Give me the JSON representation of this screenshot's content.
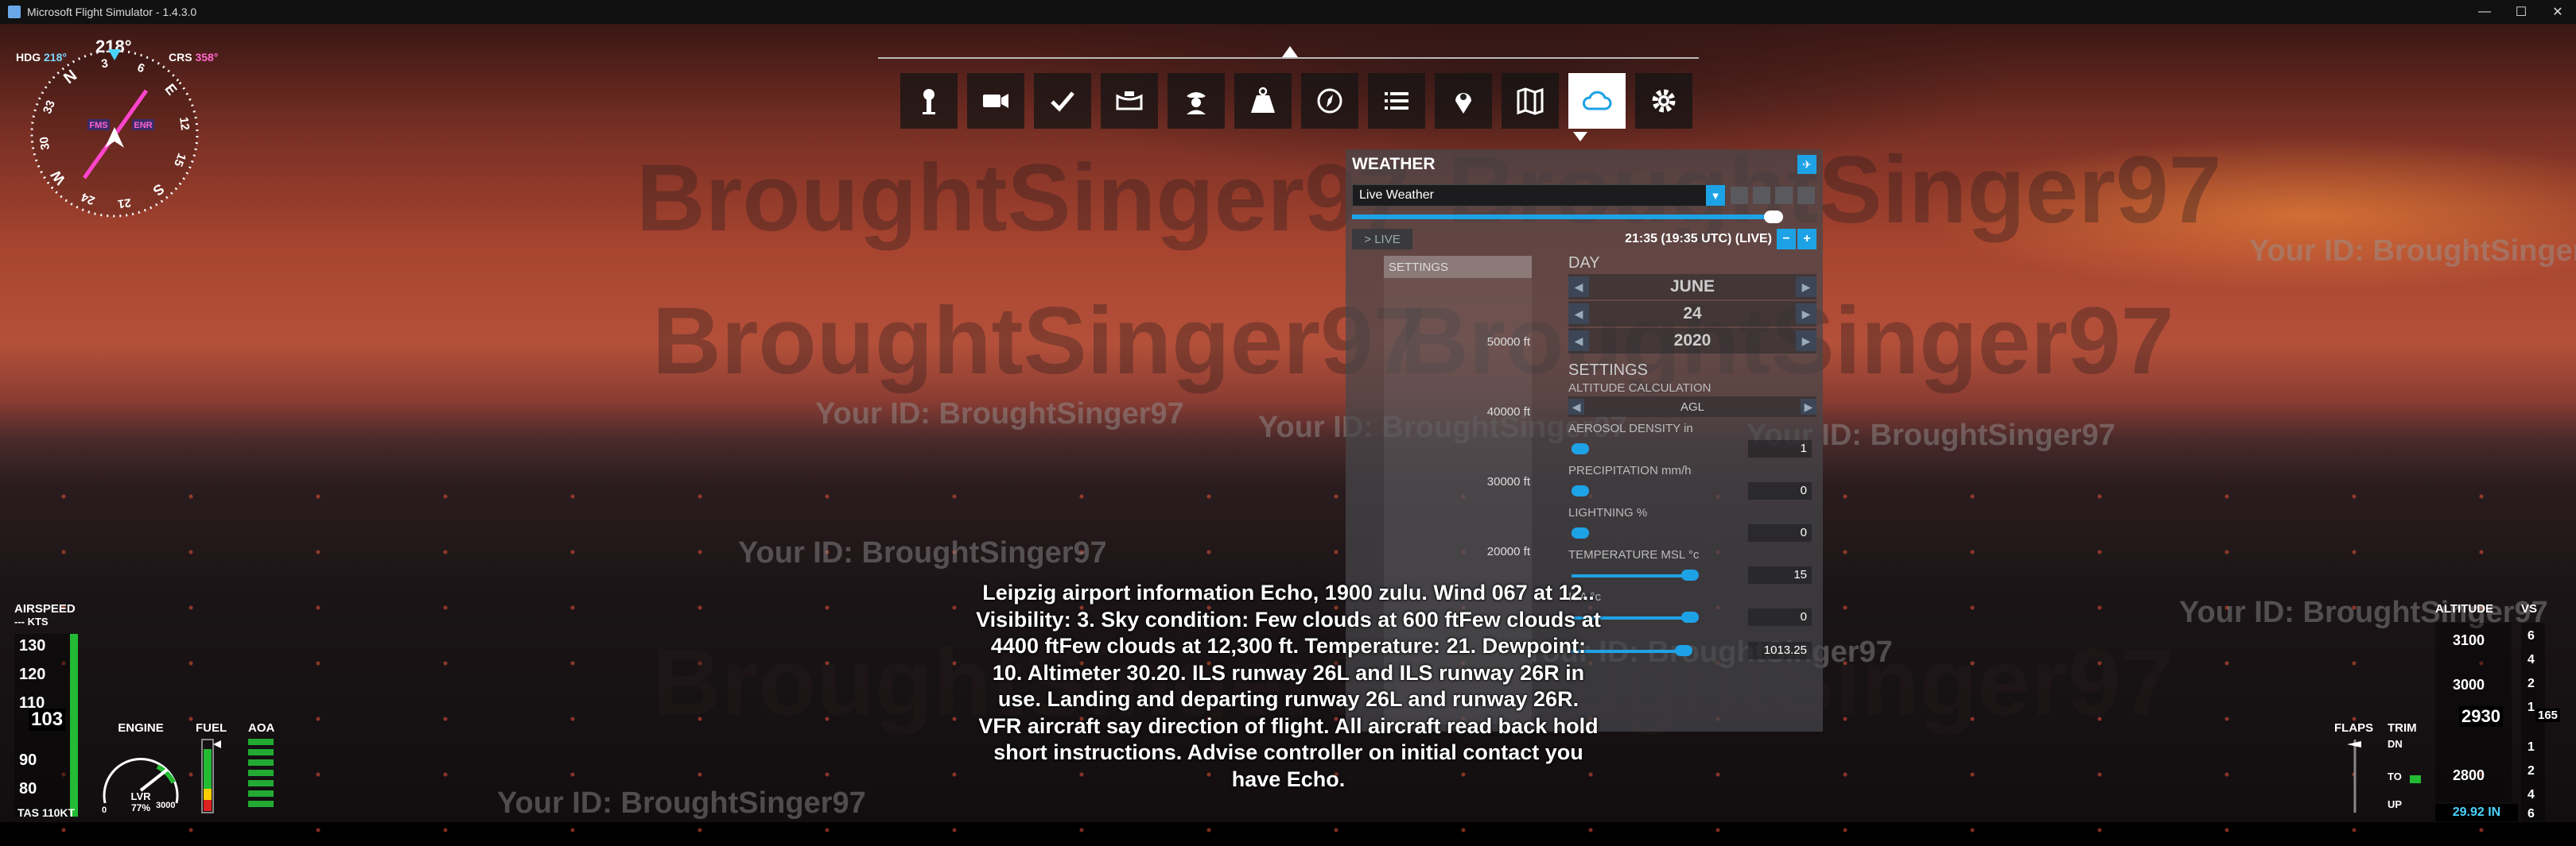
{
  "window": {
    "title": "Microsoft Flight Simulator - 1.4.3.0",
    "controls": [
      "—",
      "☐",
      "✕"
    ]
  },
  "watermark": {
    "text": "Your ID: BroughtSinger97",
    "big_text": "BroughtSinger97"
  },
  "toolbar": {
    "buttons": [
      {
        "icon": "atc-tower-icon"
      },
      {
        "icon": "camera-icon"
      },
      {
        "icon": "checklist-icon"
      },
      {
        "icon": "controls-icon"
      },
      {
        "icon": "copilot-icon"
      },
      {
        "icon": "weight-icon"
      },
      {
        "icon": "compass-icon"
      },
      {
        "icon": "list-icon"
      },
      {
        "icon": "map-pin-icon"
      },
      {
        "icon": "vfr-map-icon"
      },
      {
        "icon": "weather-cloud-icon",
        "active": true
      },
      {
        "icon": "settings-gear-icon"
      }
    ]
  },
  "weather_panel": {
    "title": "WEATHER",
    "preset": "Live Weather",
    "live_label": "LIVE",
    "time": "21:35 (19:35 UTC) (LIVE)",
    "settings_header": "SETTINGS",
    "altitudes": [
      "50000 ft",
      "40000 ft",
      "30000 ft",
      "20000 ft"
    ],
    "day_header": "DAY",
    "month": "JUNE",
    "day": "24",
    "year": "2020",
    "settings_title": "SETTINGS",
    "altitude_calc_label": "ALTITUDE CALCULATION",
    "altitude_calc_value": "AGL",
    "aerosol_label": "AEROSOL DENSITY in",
    "aerosol_value": "1",
    "precip_label": "PRECIPITATION mm/h",
    "precip_value": "0",
    "lightning_label": "LIGHTNING %",
    "lightning_value": "0",
    "temp_label": "TEMPERATURE MSL °c",
    "temp_value": "15",
    "isa_label": "ISA °c",
    "isa_value": "0",
    "pressure_value": "1013.25"
  },
  "atis": "Leipzig airport information Echo, 1900 zulu. Wind 067 at 12.. Visibility: 3. Sky condition: Few clouds at 600 ftFew clouds at 4400 ftFew clouds at 12,300 ft. Temperature: 21. Dewpoint: 10. Altimeter 30.20. ILS runway 26L and ILS runway 26R in use. Landing and departing runway 26L and runway 26R. VFR aircraft say direction of flight. All aircraft read back hold short instructions. Advise controller on initial contact you have Echo.",
  "compass": {
    "hdg_label": "HDG",
    "hdg_value": "218°",
    "heading": "218°",
    "crs_label": "CRS",
    "crs_value": "358°",
    "fms": "FMS",
    "enr": "ENR",
    "cardinals": [
      "N",
      "3",
      "6",
      "E",
      "12",
      "15",
      "S",
      "21",
      "24",
      "W",
      "30",
      "33"
    ]
  },
  "airspeed": {
    "title": "AIRSPEED",
    "unit": "--- KTS",
    "ticks": [
      "130",
      "120",
      "110",
      "100",
      "90",
      "80"
    ],
    "current": "103",
    "tas": "TAS 110KT"
  },
  "engine": {
    "title": "ENGINE",
    "lvr": "LVR",
    "pct": "77%",
    "zero": "0",
    "max": "3000"
  },
  "fuel": {
    "title": "FUEL"
  },
  "aoa": {
    "title": "AOA"
  },
  "flaps": {
    "title": "FLAPS"
  },
  "trim": {
    "title": "TRIM",
    "dn": "DN",
    "to": "TO",
    "up": "UP"
  },
  "altitude": {
    "title": "ALTITUDE",
    "ticks": [
      "3100",
      "3000",
      "2900",
      "2800"
    ],
    "current": "2930",
    "baro": "29.92 IN"
  },
  "vs": {
    "title": "VS",
    "ticks": [
      "6",
      "4",
      "2",
      "1",
      "1",
      "2",
      "4",
      "6"
    ],
    "current": "165"
  }
}
